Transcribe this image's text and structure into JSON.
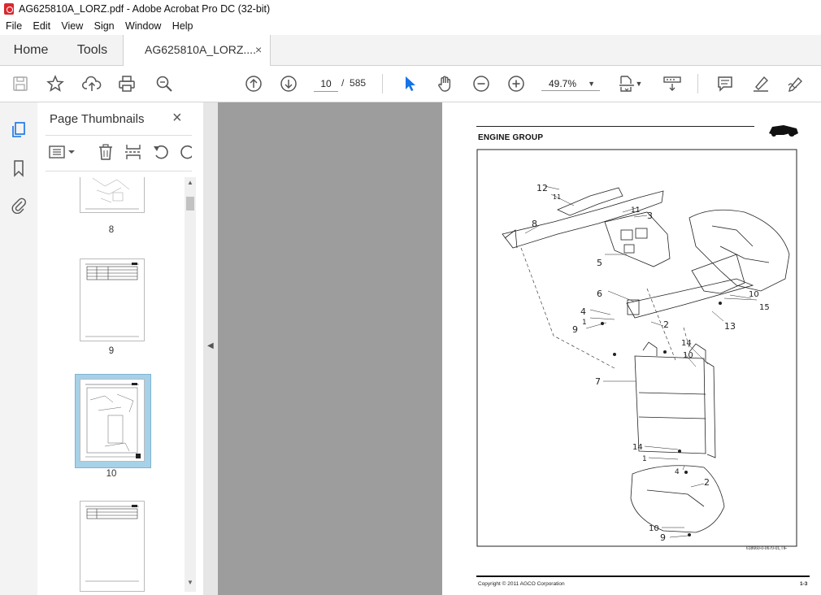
{
  "window": {
    "title": "AG625810A_LORZ.pdf - Adobe Acrobat Pro DC (32-bit)"
  },
  "menu": [
    "File",
    "Edit",
    "View",
    "Sign",
    "Window",
    "Help"
  ],
  "tabs": {
    "home": "Home",
    "tools": "Tools",
    "document": "AG625810A_LORZ....",
    "close": "×"
  },
  "toolbar": {
    "current_page": "10",
    "page_separator": "/",
    "total_pages": "585",
    "zoom": "49.7%"
  },
  "thumbnails": {
    "title": "Page Thumbnails",
    "close": "×",
    "pages": [
      {
        "label": "8"
      },
      {
        "label": "9"
      },
      {
        "label": "10",
        "selected": true
      },
      {
        "label": ""
      }
    ]
  },
  "document_page": {
    "heading": "ENGINE GROUP",
    "figure_id": "618660-0-0670-01,TIF",
    "copyright": "Copyright © 2011 AGCO Corporation",
    "page_number": "1-3",
    "callouts": [
      "12",
      "11",
      "11",
      "3",
      "8",
      "5",
      "6",
      "10",
      "15",
      "4",
      "1",
      "2",
      "9",
      "13",
      "14",
      "10",
      "7",
      "14",
      "1",
      "4",
      "2",
      "10",
      "9"
    ]
  },
  "colors": {
    "accent_blue": "#1473e6",
    "doc_background": "#9d9d9d",
    "selected_thumb": "#a7d1e8"
  }
}
